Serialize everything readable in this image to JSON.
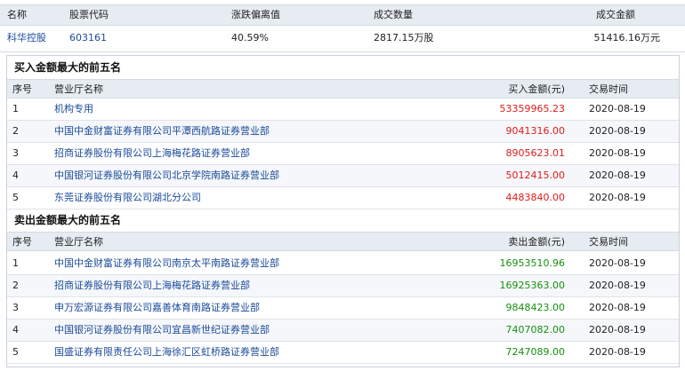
{
  "summary": {
    "headers": [
      "名称",
      "股票代码",
      "涨跌偏离值",
      "成交数量",
      "成交金额"
    ],
    "values": [
      "科华控股",
      "603161",
      "40.59%",
      "2817.15万股",
      "51416.16万元"
    ]
  },
  "buy": {
    "title": "买入金额最大的前五名",
    "headers": [
      "序号",
      "营业厅名称",
      "买入金额(元)",
      "交易时间"
    ],
    "rows": [
      {
        "no": "1",
        "name": "机构专用",
        "amount": "53359965.23",
        "date": "2020-08-19"
      },
      {
        "no": "2",
        "name": "中国中金财富证券有限公司平潭西航路证券营业部",
        "amount": "9041316.00",
        "date": "2020-08-19"
      },
      {
        "no": "3",
        "name": "招商证券股份有限公司上海梅花路证券营业部",
        "amount": "8905623.01",
        "date": "2020-08-19"
      },
      {
        "no": "4",
        "name": "中国银河证券股份有限公司北京学院南路证券营业部",
        "amount": "5012415.00",
        "date": "2020-08-19"
      },
      {
        "no": "5",
        "name": "东莞证券股份有限公司湖北分公司",
        "amount": "4483840.00",
        "date": "2020-08-19"
      }
    ]
  },
  "sell": {
    "title": "卖出金额最大的前五名",
    "headers": [
      "序号",
      "营业厅名称",
      "卖出金额(元)",
      "交易时间"
    ],
    "rows": [
      {
        "no": "1",
        "name": "中国中金财富证券有限公司南京太平南路证券营业部",
        "amount": "16953510.96",
        "date": "2020-08-19"
      },
      {
        "no": "2",
        "name": "招商证券股份有限公司上海梅花路证券营业部",
        "amount": "16925363.00",
        "date": "2020-08-19"
      },
      {
        "no": "3",
        "name": "申万宏源证券有限公司嘉善体育南路证券营业部",
        "amount": "9848423.00",
        "date": "2020-08-19"
      },
      {
        "no": "4",
        "name": "中国银河证券股份有限公司宜昌新世纪证券营业部",
        "amount": "7407082.00",
        "date": "2020-08-19"
      },
      {
        "no": "5",
        "name": "国盛证券有限责任公司上海徐汇区虹桥路证券营业部",
        "amount": "7247089.00",
        "date": "2020-08-19"
      }
    ]
  },
  "colors": {
    "buy_amount": "#e01b1b",
    "sell_amount": "#14910f",
    "link": "#1a4a9a",
    "header_bg": "#e7ecf2"
  }
}
